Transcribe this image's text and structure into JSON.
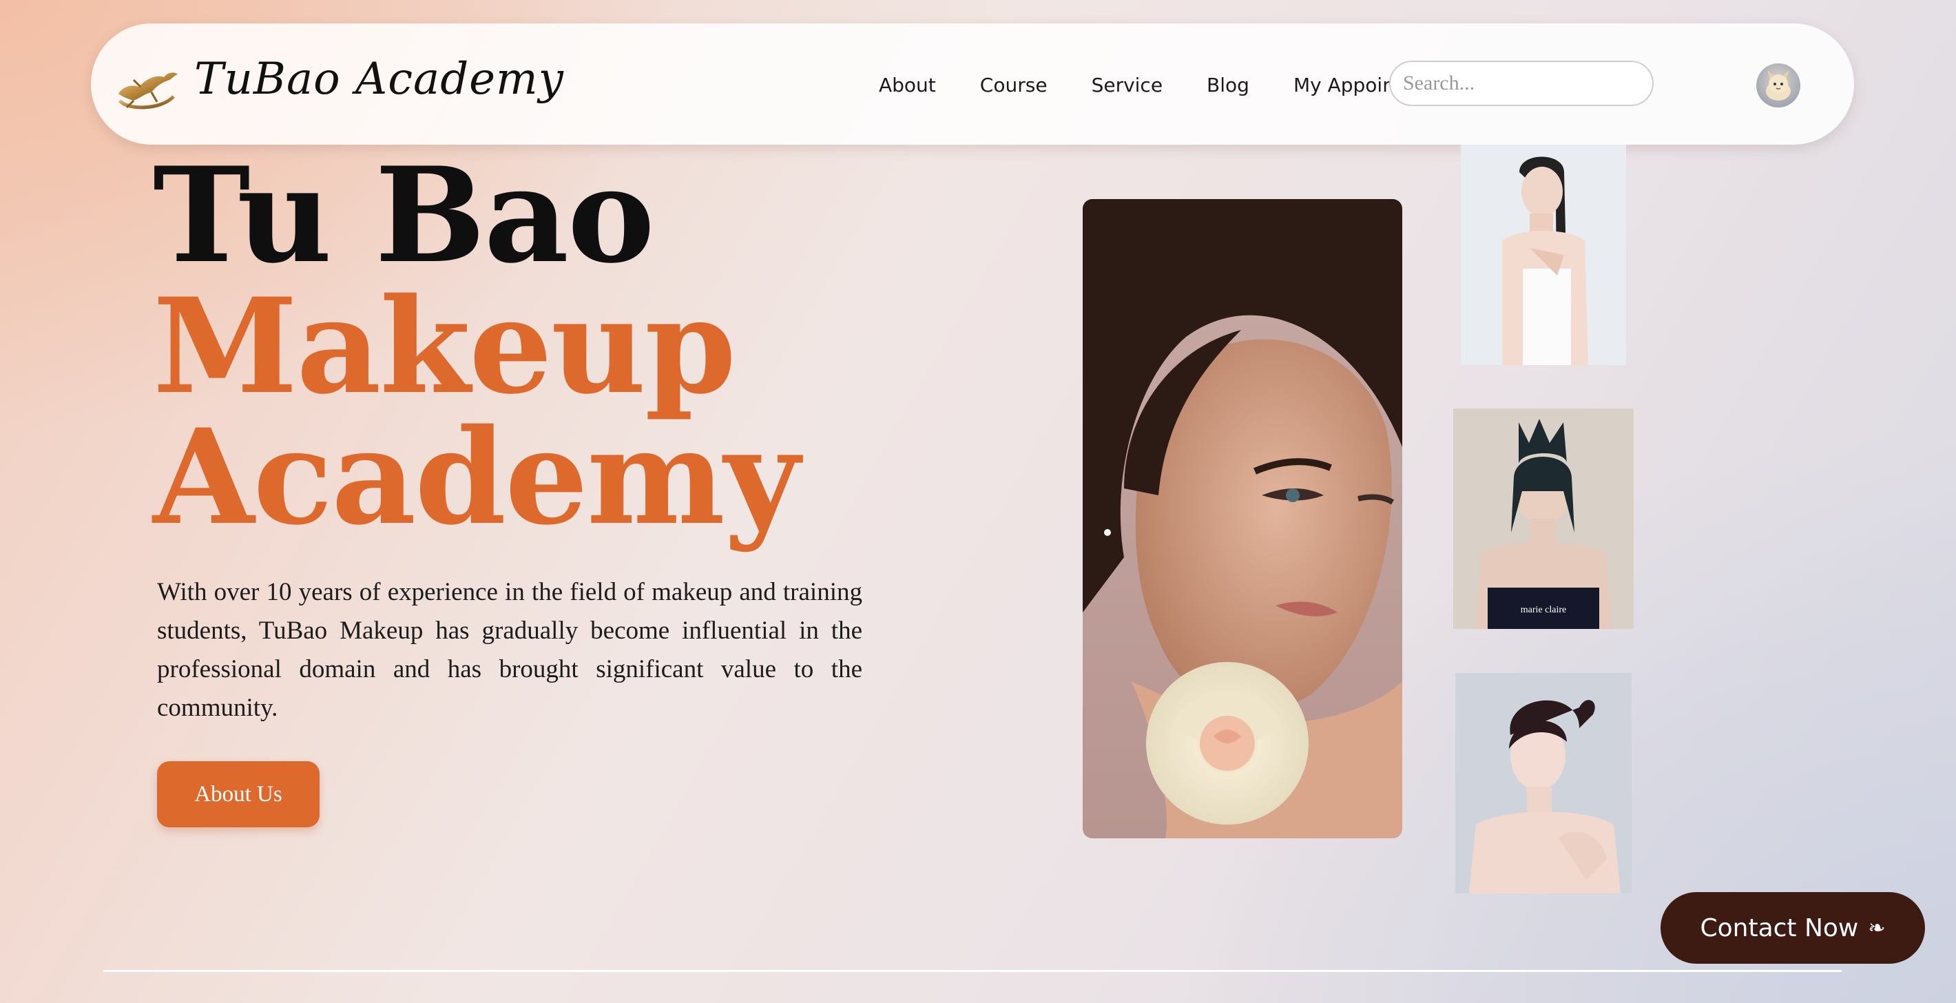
{
  "header": {
    "brand": "TuBao Academy",
    "nav": [
      "About",
      "Course",
      "Service",
      "Blog",
      "My Appointment"
    ],
    "search_placeholder": "Search..."
  },
  "hero": {
    "title_line1": "Tu Bao",
    "title_line2": "Makeup",
    "title_line3": "Academy",
    "description": "With over 10 years of experience in the field of makeup and training students, TuBao Makeup has gradually become influential in the professional domain and has brought significant value to the community.",
    "cta_label": "About Us"
  },
  "contact": {
    "label": "Contact Now",
    "icon_glyph": "❧"
  },
  "colors": {
    "accent": "#dd6a2c",
    "dark": "#3d1b12"
  },
  "icons": [
    "logo-horse-icon",
    "avatar-icon",
    "contact-icon"
  ]
}
